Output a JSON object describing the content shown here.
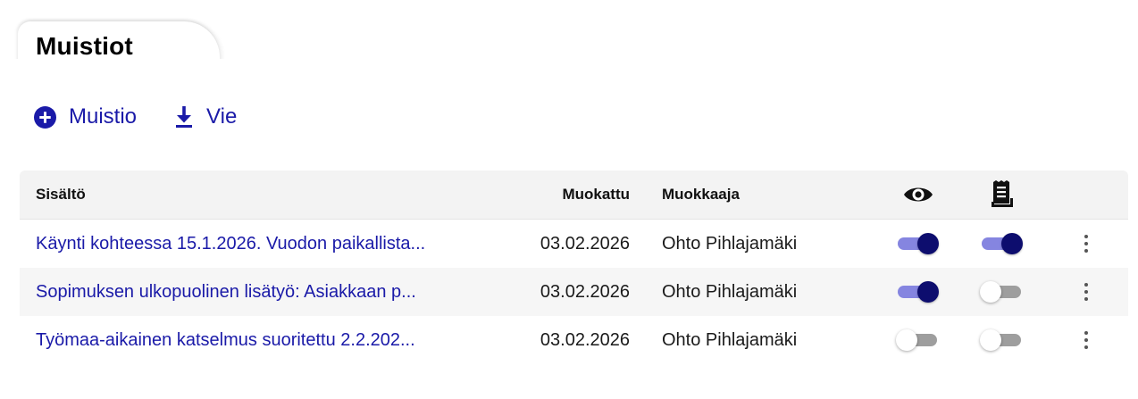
{
  "page": {
    "title": "Muistiot"
  },
  "actions": {
    "add_label": "Muistio",
    "export_label": "Vie"
  },
  "colors": {
    "accent": "#1a1aa8",
    "toggle_on_knob": "#0d0d6e",
    "toggle_on_track": "#8585e0",
    "toggle_off_track": "#9e9e9e"
  },
  "table": {
    "headers": {
      "content": "Sisältö",
      "modified": "Muokattu",
      "editor": "Muokkaaja",
      "visible_icon": "eye-icon",
      "print_icon": "receipt-icon"
    },
    "rows": [
      {
        "content": "Käynti kohteessa 15.1.2026. Vuodon paikallista...",
        "modified": "03.02.2026",
        "editor": "Ohto Pihlajamäki",
        "visible": true,
        "print": true
      },
      {
        "content": "Sopimuksen ulkopuolinen lisätyö: Asiakkaan p...",
        "modified": "03.02.2026",
        "editor": "Ohto Pihlajamäki",
        "visible": true,
        "print": false
      },
      {
        "content": "Työmaa-aikainen katselmus suoritettu 2.2.202...",
        "modified": "03.02.2026",
        "editor": "Ohto Pihlajamäki",
        "visible": false,
        "print": false
      }
    ]
  }
}
